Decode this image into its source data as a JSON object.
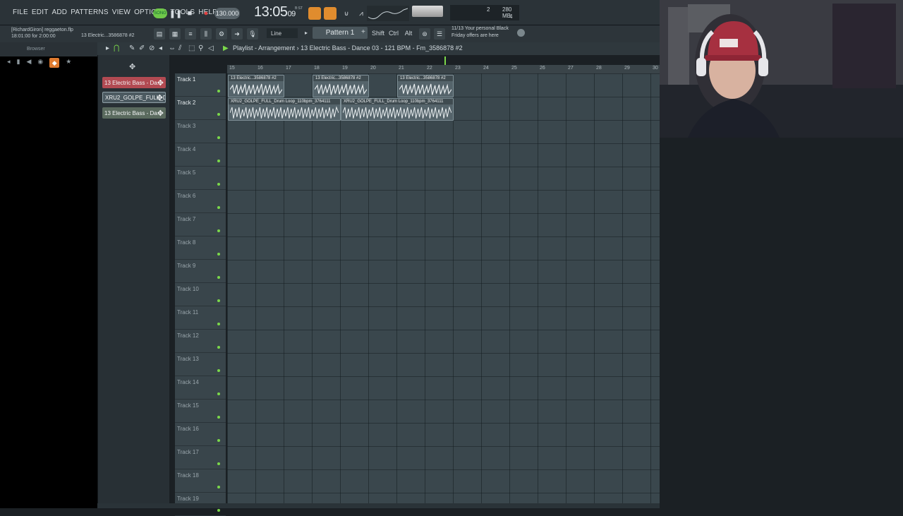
{
  "menu": [
    "FILE",
    "EDIT",
    "ADD",
    "PATTERNS",
    "VIEW",
    "OPTIONS",
    "TOOLS",
    "HELP"
  ],
  "transport": {
    "song_label": "SONG",
    "tempo": "130.000",
    "time_main": "13:05",
    "time_sub": "09",
    "time_unit": "B:ST"
  },
  "cpu": {
    "voices": "2",
    "mem": "280 MB",
    "poly": "4"
  },
  "hint": {
    "line1": "[RichardGiron] reggaeton.flp",
    "line2": "18:01:00 for 2:00:00",
    "line3": "13 Electric...3586878 #2"
  },
  "toolbar": {
    "snap": "Line",
    "pattern": "Pattern 1",
    "shift": "Shift",
    "ctrl": "Ctrl",
    "alt": "Alt"
  },
  "promo": {
    "date": "11/13",
    "line1": "Your personal Black",
    "line2": "Friday offers are here"
  },
  "browser": {
    "title": "Browser"
  },
  "clips": [
    "13 Electric Bass - Da...",
    "XRU2_GOLPE_FULL_D...",
    "13 Electric Bass - Da..."
  ],
  "playlist": {
    "title": "Playlist - Arrangement",
    "breadcrumb": "13 Electric Bass - Dance 03 - 121 BPM - Fm_3586878 #2"
  },
  "ruler": [
    "15",
    "16",
    "17",
    "18",
    "19",
    "20",
    "21",
    "22",
    "23",
    "24",
    "25",
    "26",
    "27",
    "28",
    "29",
    "30"
  ],
  "tracks": [
    "Track 1",
    "Track 2",
    "Track 3",
    "Track 4",
    "Track 5",
    "Track 6",
    "Track 7",
    "Track 8",
    "Track 9",
    "Track 10",
    "Track 11",
    "Track 12",
    "Track 13",
    "Track 14",
    "Track 15",
    "Track 16",
    "Track 17",
    "Track 18",
    "Track 19"
  ],
  "audio_clips": {
    "bass": "13 Electric...3586878 #2",
    "drum": "XRU2_GOLPE_FULL_Drum Loop_110bpm_3764111"
  },
  "colors": {
    "accent": "#e08c2e",
    "clip": "#55646b",
    "grid": "#3a474d",
    "green": "#7bd84a"
  }
}
